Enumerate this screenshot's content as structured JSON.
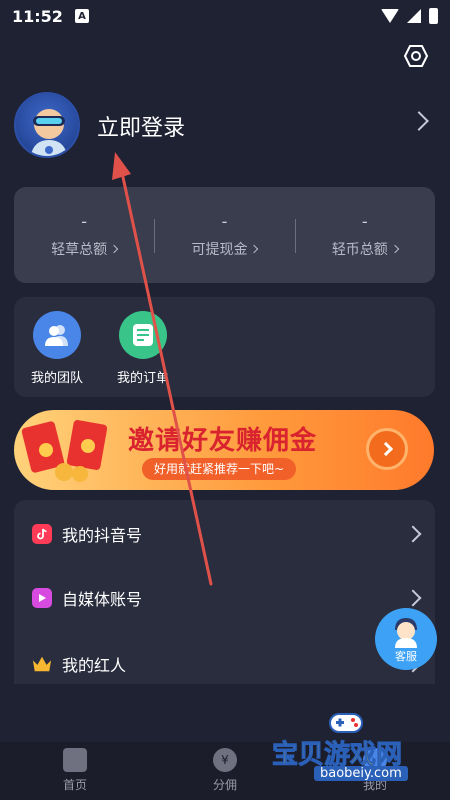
{
  "status_bar": {
    "time": "11:52",
    "notification_glyph": "A"
  },
  "header": {
    "settings_icon": "settings-hexagon-icon"
  },
  "profile": {
    "login_title": "立即登录"
  },
  "stats": [
    {
      "value": "-",
      "label": "轻草总额"
    },
    {
      "value": "-",
      "label": "可提现金"
    },
    {
      "value": "-",
      "label": "轻币总额"
    }
  ],
  "shortcuts": [
    {
      "label": "我的团队",
      "icon": "team-icon"
    },
    {
      "label": "我的订单",
      "icon": "order-icon"
    }
  ],
  "banner": {
    "title": "邀请好友赚佣金",
    "subtitle": "好用就赶紧推荐一下吧~"
  },
  "menu": [
    {
      "label": "我的抖音号",
      "icon": "douyin-icon"
    },
    {
      "label": "自媒体账号",
      "icon": "media-play-icon"
    },
    {
      "label": "我的红人",
      "icon": "crown-icon"
    }
  ],
  "service": {
    "label": "客服"
  },
  "bottom_nav": [
    {
      "label": "首页",
      "icon": "home-icon"
    },
    {
      "label": "分佣",
      "icon": "yuan-icon",
      "glyph": "¥"
    },
    {
      "label": "我的",
      "icon": "profile-icon"
    }
  ],
  "watermark": {
    "text": "宝贝游戏网",
    "url": "baobeiy.com"
  },
  "colors": {
    "background": "#1f2233",
    "card": "#2a2d3e",
    "stats_card": "#3a3d4e",
    "banner_title": "#d9232f",
    "arrow": "#e0514a"
  }
}
